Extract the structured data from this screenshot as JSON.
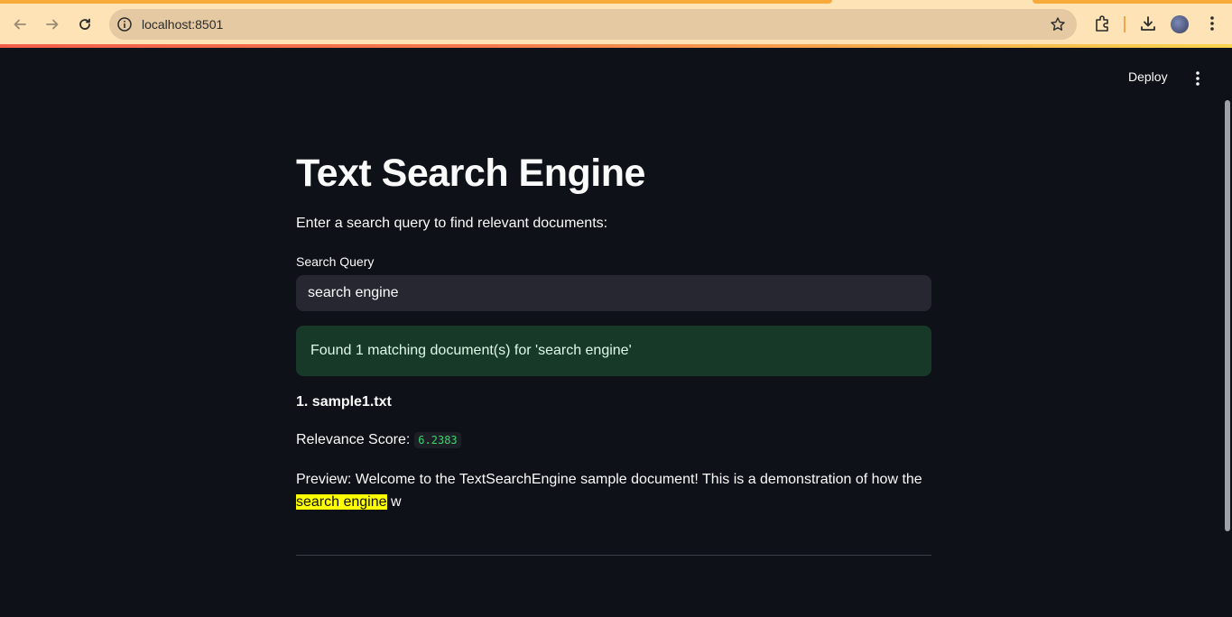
{
  "browser": {
    "url": "localhost:8501"
  },
  "app": {
    "deploy_label": "Deploy",
    "title": "Text Search Engine",
    "subtitle": "Enter a search query to find relevant documents:",
    "search": {
      "label": "Search Query",
      "value": "search engine"
    },
    "success_message": "Found 1 matching document(s) for 'search engine'",
    "results": [
      {
        "title": "1. sample1.txt",
        "score_label": "Relevance Score:",
        "score": "6.2383",
        "preview_prefix": "Preview: Welcome to the TextSearchEngine sample document! This is a demonstration of how the ",
        "preview_highlight": "search engine",
        "preview_suffix": " w"
      }
    ]
  },
  "colors": {
    "background": "#0e1117",
    "success_bg": "#173928",
    "highlight": "#ffff00",
    "score_text": "#3dd56d"
  }
}
